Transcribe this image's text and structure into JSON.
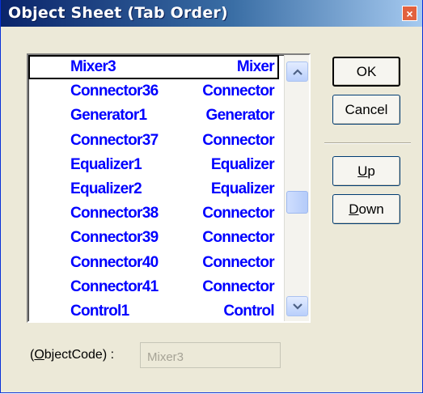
{
  "window": {
    "title": "Object Sheet (Tab Order)",
    "close_label": "×"
  },
  "list": {
    "selected_index": 0,
    "items": [
      {
        "name": "Mixer3",
        "type": "Mixer"
      },
      {
        "name": "Connector36",
        "type": "Connector"
      },
      {
        "name": "Generator1",
        "type": "Generator"
      },
      {
        "name": "Connector37",
        "type": "Connector"
      },
      {
        "name": "Equalizer1",
        "type": "Equalizer"
      },
      {
        "name": "Equalizer2",
        "type": "Equalizer"
      },
      {
        "name": "Connector38",
        "type": "Connector"
      },
      {
        "name": "Connector39",
        "type": "Connector"
      },
      {
        "name": "Connector40",
        "type": "Connector"
      },
      {
        "name": "Connector41",
        "type": "Connector"
      },
      {
        "name": "Control1",
        "type": "Control"
      }
    ]
  },
  "buttons": {
    "ok": "OK",
    "cancel": "Cancel",
    "up_mnemonic": "U",
    "up_rest": "p",
    "down_mnemonic": "D",
    "down_rest": "own"
  },
  "object_code": {
    "label_prefix": "(",
    "label_mnemonic": "O",
    "label_rest": "bjectCode) :",
    "value": "Mixer3"
  },
  "icons": {
    "scroll_up": "chevron-up-icon",
    "scroll_down": "chevron-down-icon",
    "close": "close-icon"
  },
  "colors": {
    "title_bar_start": "#0a246a",
    "title_bar_end": "#a6caf0",
    "list_text": "#0000ff",
    "dialog_bg": "#ece9d8",
    "close_button": "#e2613e"
  }
}
